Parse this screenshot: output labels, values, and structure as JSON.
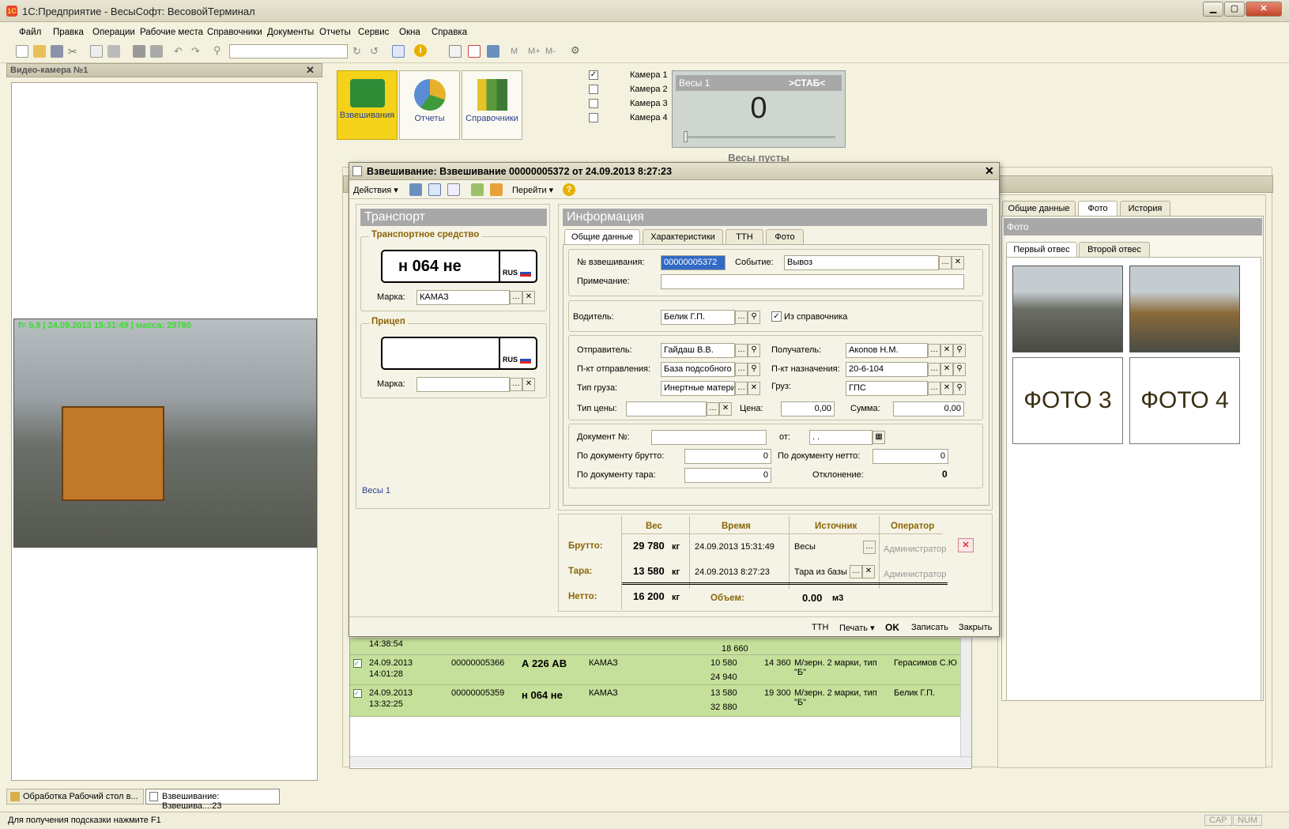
{
  "window": {
    "title": "1С:Предприятие - ВесыСофт: ВесовойТерминал",
    "logo_text": "1С"
  },
  "menu": [
    "Файл",
    "Правка",
    "Операции",
    "Рабочие места",
    "Справочники",
    "Документы",
    "Отчеты",
    "Сервис",
    "Окна",
    "Справка"
  ],
  "toolbar": {
    "mem_buttons": [
      "M",
      "M+",
      "M-"
    ]
  },
  "video_panel": {
    "title": "Видео-камера №1",
    "overlay": "f= 5,9 | 24.09.2013 15:31:49 | масса: 29780"
  },
  "launcher": {
    "items": [
      {
        "label": "Взвешивания"
      },
      {
        "label": "Отчеты"
      },
      {
        "label": "Справочники"
      }
    ]
  },
  "cameras": [
    {
      "label": "Камера 1",
      "checked": true
    },
    {
      "label": "Камера 2",
      "checked": false
    },
    {
      "label": "Камера 3",
      "checked": false
    },
    {
      "label": "Камера 4",
      "checked": false
    }
  ],
  "scale": {
    "name": "Весы 1",
    "status": ">СТАБ<",
    "value": "0",
    "caption": "Весы пусты"
  },
  "dialog": {
    "title": "Взвешивание: Взвешивание 00000005372 от 24.09.2013 8:27:23",
    "toolbar": {
      "actions": "Действия",
      "goto": "Перейти"
    },
    "transport": {
      "header": "Транспорт",
      "vehicle_group": "Транспортное средство",
      "plate": "н 064 не",
      "plate_country": "RUS",
      "brand_label": "Марка:",
      "brand_value": "КАМАЗ",
      "trailer_group": "Прицеп",
      "trailer_brand_label": "Марка:",
      "trailer_brand_value": "",
      "scales_link": "Весы 1"
    },
    "info": {
      "header": "Информация",
      "tabs": [
        "Общие данные",
        "Характеристики",
        "ТТН",
        "Фото"
      ],
      "weighing_no_label": "№ взвешивания:",
      "weighing_no": "00000005372",
      "event_label": "Событие:",
      "event": "Вывоз",
      "note_label": "Примечание:",
      "note": "",
      "driver_label": "Водитель:",
      "driver": "Белик Г.П.",
      "from_ref_label": "Из справочника",
      "from_ref_checked": true,
      "sender_label": "Отправитель:",
      "sender": "Гайдаш В.В.",
      "receiver_label": "Получатель:",
      "receiver": "Акопов Н.М.",
      "origin_label": "П-кт отправления:",
      "origin": "База подсобного",
      "dest_label": "П-кт назначения:",
      "dest": "20-6-104",
      "cargo_type_label": "Тип груза:",
      "cargo_type": "Инертные матери",
      "cargo_label": "Груз:",
      "cargo": "ГПС",
      "price_type_label": "Тип цены:",
      "price_type": "",
      "price_label": "Цена:",
      "price": "0,00",
      "sum_label": "Сумма:",
      "sum": "0,00",
      "doc_no_label": "Документ №:",
      "doc_no": "",
      "doc_from_label": "от:",
      "doc_date": " .  .",
      "doc_gross_label": "По документу брутто:",
      "doc_gross": "0",
      "doc_net_label": "По документу нетто:",
      "doc_net": "0",
      "doc_tare_label": "По документу тара:",
      "doc_tare": "0",
      "deviation_label": "Отклонение:",
      "deviation": "0"
    },
    "weights": {
      "headers": [
        "Вес",
        "Время",
        "Источник",
        "Оператор"
      ],
      "rows": [
        {
          "label": "Брутто:",
          "weight": "29 780",
          "unit": "кг",
          "time": "24.09.2013 15:31:49",
          "source": "Весы",
          "operator": "Администратор"
        },
        {
          "label": "Тара:",
          "weight": "13 580",
          "unit": "кг",
          "time": "24.09.2013  8:27:23",
          "source": "Тара из базы",
          "operator": "Администратор"
        }
      ],
      "net_label": "Нетто:",
      "net_weight": "16 200",
      "net_unit": "кг",
      "volume_label": "Объем:",
      "volume": "0.00",
      "volume_unit": "м3"
    },
    "footer": [
      "ТТН",
      "Печать",
      "OK",
      "Записать",
      "Закрыть"
    ]
  },
  "journal_rows": [
    {
      "date": "",
      "time": "14:38:54",
      "number": "",
      "plate": "",
      "brand": "",
      "w1": "18 660",
      "w2": "",
      "w3": "",
      "cargo": "",
      "driver": ""
    },
    {
      "date": "24.09.2013",
      "time": "14:01:28",
      "number": "00000005366",
      "plate": "А 226 АВ",
      "brand": "КАМАЗ",
      "w1": "10 580",
      "w2": "24 940",
      "w3": "14 360",
      "cargo": "М/зерн. 2 марки, тип \"Б\"",
      "driver": "Герасимов С.Ю"
    },
    {
      "date": "24.09.2013",
      "time": "13:32:25",
      "number": "00000005359",
      "plate": "н 064 не",
      "brand": "КАМАЗ",
      "w1": "13 580",
      "w2": "32 880",
      "w3": "19 300",
      "cargo": "М/зерн. 2 марки, тип \"Б\"",
      "driver": "Белик Г.П."
    }
  ],
  "right_panel": {
    "tabs": [
      "Общие данные",
      "Фото",
      "История"
    ],
    "header": "Фото",
    "subtabs": [
      "Первый отвес",
      "Второй отвес"
    ],
    "photo3": "ФОТО 3",
    "photo4": "ФОТО 4"
  },
  "taskbar": [
    "Обработка  Рабочий стол в...",
    "Взвешивание: Взвешива...:23"
  ],
  "status": {
    "hint": "Для получения подсказки нажмите F1",
    "cap": "CAP",
    "num": "NUM"
  }
}
